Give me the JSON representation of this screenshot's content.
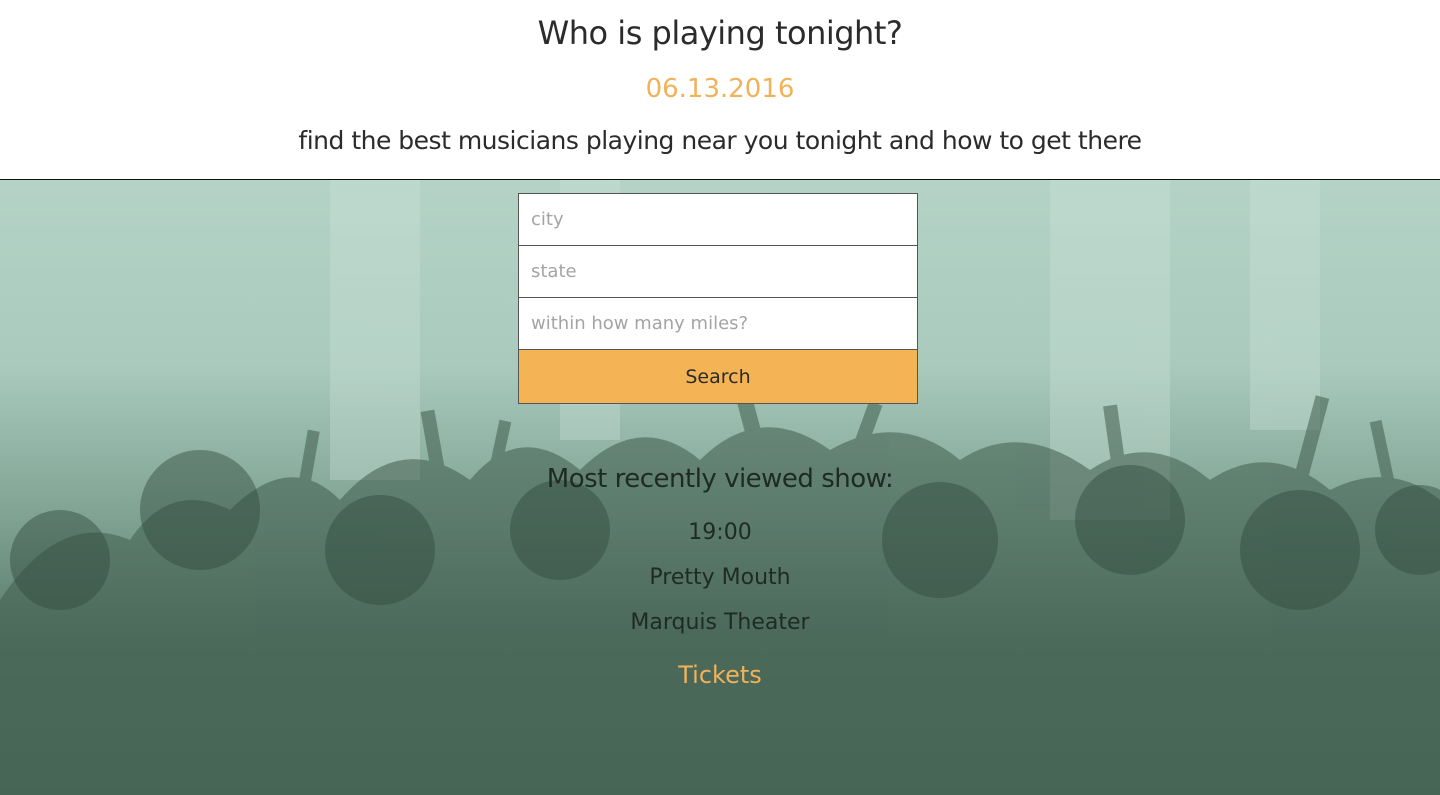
{
  "header": {
    "title": "Who is playing tonight?",
    "date": "06.13.2016",
    "subtitle": "find the best musicians playing near you tonight and how to get there"
  },
  "search": {
    "city_placeholder": "city",
    "state_placeholder": "state",
    "miles_placeholder": "within how many miles?",
    "button_label": "Search"
  },
  "recent_show": {
    "heading": "Most recently viewed show:",
    "time": "19:00",
    "artist": "Pretty Mouth",
    "venue": "Marquis Theater",
    "tickets_label": "Tickets"
  },
  "colors": {
    "accent": "#f4b354",
    "hero_tint": "#7fa293"
  }
}
